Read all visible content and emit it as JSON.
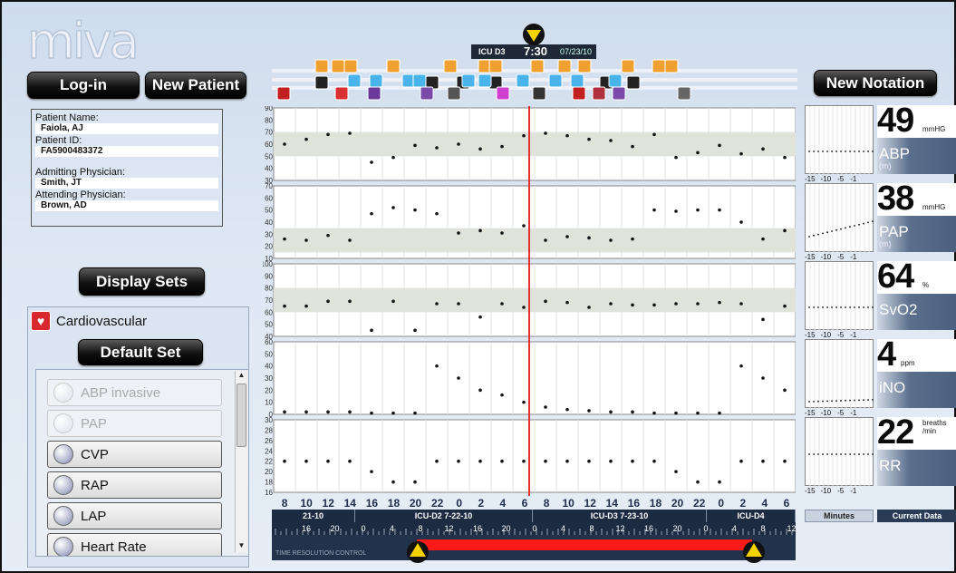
{
  "app": {
    "logo_text": "miva"
  },
  "buttons": {
    "login": "Log-in",
    "new_patient": "New Patient",
    "new_notation": "New Notation",
    "display_sets": "Display Sets",
    "default_set": "Default Set"
  },
  "patient": {
    "name_label": "Patient Name:",
    "name": "Faiola, AJ",
    "id_label": "Patient ID:",
    "id": "FA5900483372",
    "admitting_label": "Admitting Physician:",
    "admitting": "Smith, JT",
    "attending_label": "Attending Physician:",
    "attending": "Brown, AD"
  },
  "set_category": "Cardiovascular",
  "set_items": [
    {
      "label": "ABP invasive",
      "enabled": false
    },
    {
      "label": "PAP",
      "enabled": false
    },
    {
      "label": "CVP",
      "enabled": true
    },
    {
      "label": "RAP",
      "enabled": true
    },
    {
      "label": "LAP",
      "enabled": true
    },
    {
      "label": "Heart Rate",
      "enabled": true
    }
  ],
  "header": {
    "location": "ICU D3",
    "time": "7:30",
    "date": "07/23/10"
  },
  "x_axis": {
    "hours": [
      "8",
      "10",
      "12",
      "14",
      "16",
      "18",
      "20",
      "22",
      "0",
      "2",
      "4",
      "6",
      "8",
      "10",
      "12",
      "14",
      "16",
      "18",
      "20",
      "22",
      "0",
      "2",
      "4",
      "6"
    ]
  },
  "time_segments": [
    "21-10",
    "ICU-D2  7-22-10",
    "ICU-D3  7-23-10",
    "ICU-D4"
  ],
  "ruler_labels": [
    "16",
    "20",
    "0",
    "4",
    "8",
    "12",
    "16",
    "20",
    "0",
    "4",
    "8",
    "12",
    "16",
    "20",
    "0",
    "4",
    "8",
    "12"
  ],
  "resolution_label": "TIME RESOLUTION CONTROL",
  "right_footer": {
    "minutes": "Minutes",
    "current": "Current Data"
  },
  "mini_ticks": [
    "-15",
    "-10",
    "-5",
    "-1"
  ],
  "vitals": [
    {
      "value": "49",
      "unit": "mmHG",
      "name": "ABP",
      "sub": "(m)"
    },
    {
      "value": "38",
      "unit": "mmHG",
      "name": "PAP",
      "sub": "(m)"
    },
    {
      "value": "64",
      "unit": "%",
      "name": "SvO2",
      "sub": ""
    },
    {
      "value": "4",
      "unit": "ppm",
      "name": "iNO",
      "sub": ""
    },
    {
      "value": "22",
      "unit": "breaths /min",
      "name": "RR",
      "sub": ""
    }
  ],
  "chart_data": [
    {
      "type": "scatter",
      "name": "ABP",
      "ylim": [
        30,
        90
      ],
      "yticks": [
        30,
        40,
        50,
        60,
        70,
        80,
        90
      ],
      "band": [
        50,
        70
      ],
      "values": [
        60,
        64,
        68,
        69,
        45,
        49,
        59,
        57,
        60,
        56,
        58,
        67,
        69,
        67,
        64,
        63,
        58,
        68,
        49,
        53,
        59,
        52,
        56,
        49
      ]
    },
    {
      "type": "scatter",
      "name": "PAP",
      "ylim": [
        10,
        70
      ],
      "yticks": [
        10,
        20,
        30,
        40,
        50,
        60,
        70
      ],
      "band": [
        15,
        35
      ],
      "values": [
        26,
        25,
        29,
        25,
        47,
        52,
        50,
        47,
        31,
        33,
        31,
        37,
        25,
        28,
        27,
        25,
        26,
        50,
        49,
        50,
        50,
        40,
        26,
        33
      ]
    },
    {
      "type": "scatter",
      "name": "SvO2",
      "ylim": [
        40,
        100
      ],
      "yticks": [
        40,
        50,
        60,
        70,
        80,
        90,
        100
      ],
      "band": [
        60,
        80
      ],
      "values": [
        65,
        65,
        69,
        69,
        45,
        69,
        45,
        67,
        67,
        56,
        67,
        64,
        69,
        68,
        64,
        67,
        66,
        66,
        67,
        67,
        68,
        67,
        54,
        65
      ]
    },
    {
      "type": "scatter",
      "name": "iNO",
      "ylim": [
        0,
        60
      ],
      "yticks": [
        0,
        10,
        20,
        30,
        40,
        50,
        60
      ],
      "band": null,
      "values": [
        2,
        2,
        2,
        2,
        1,
        1,
        1,
        40,
        30,
        20,
        16,
        10,
        6,
        4,
        3,
        2,
        2,
        1,
        1,
        1,
        1,
        40,
        30,
        20
      ]
    },
    {
      "type": "scatter",
      "name": "RR",
      "ylim": [
        16,
        30
      ],
      "yticks": [
        16,
        18,
        20,
        22,
        24,
        26,
        28,
        30
      ],
      "band": null,
      "values": [
        22,
        22,
        22,
        22,
        20,
        18,
        18,
        22,
        22,
        22,
        22,
        22,
        22,
        22,
        22,
        22,
        22,
        22,
        20,
        18,
        18,
        22,
        22,
        22
      ]
    }
  ],
  "colors": {
    "current_time_line": "#e53030",
    "band": "#dfe3d9",
    "resolution_bar": "#ff1a1a",
    "marker": "#f5d300"
  }
}
